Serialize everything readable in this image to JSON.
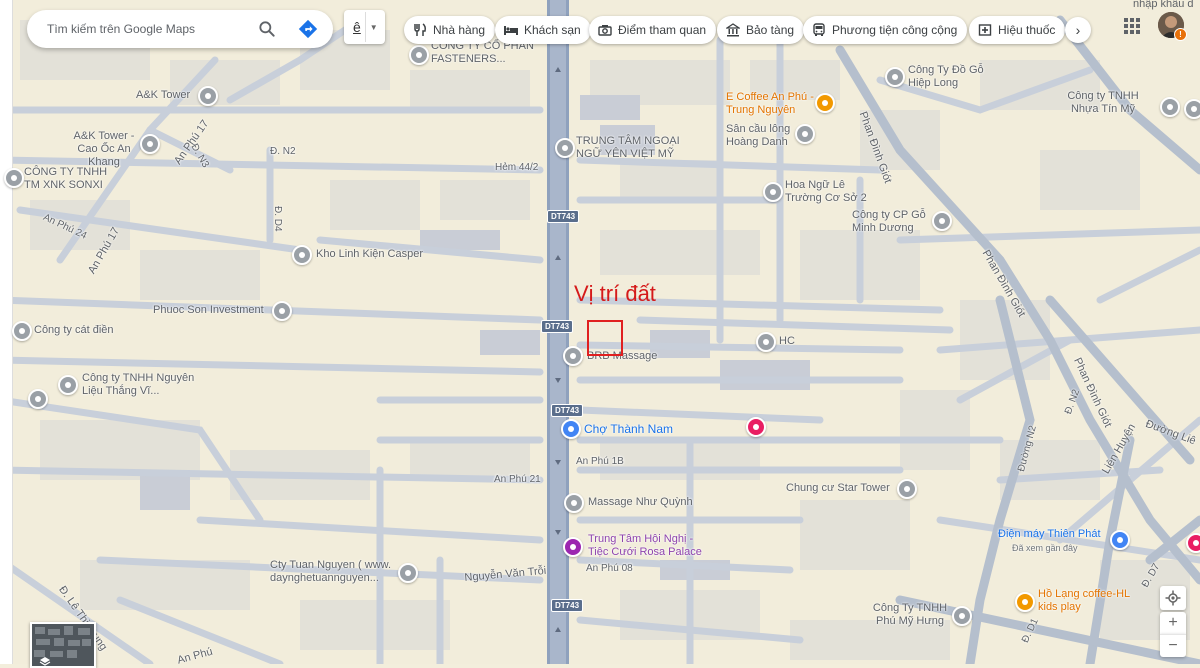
{
  "search": {
    "placeholder": "Tìm kiếm trên Google Maps"
  },
  "language_button": {
    "label": "ê"
  },
  "category_chips": [
    {
      "label": "Nhà hàng",
      "icon": "fork-knife-icon"
    },
    {
      "label": "Khách sạn",
      "icon": "bed-icon"
    },
    {
      "label": "Điểm tham quan",
      "icon": "camera-icon"
    },
    {
      "label": "Bảo tàng",
      "icon": "museum-icon"
    },
    {
      "label": "Phương tiện công cộng",
      "icon": "bus-icon"
    },
    {
      "label": "Hiệu thuốc",
      "icon": "pharmacy-icon"
    }
  ],
  "annotation": {
    "text": "Vị trí đất",
    "color": "#d51a1a"
  },
  "pois": [
    {
      "name": "A&K Tower",
      "kind": "grey"
    },
    {
      "name": "A&K Tower - Cao Ốc An Khang",
      "kind": "grey"
    },
    {
      "name": "CÔNG TY TNHH TM XNK SONXI",
      "kind": "grey"
    },
    {
      "name": "Kho Linh Kiện Casper",
      "kind": "grey"
    },
    {
      "name": "Phuoc Son Investment",
      "kind": "grey"
    },
    {
      "name": "Công ty cát điền",
      "kind": "grey"
    },
    {
      "name": "Công ty TNHH Nguyên Liệu Thắng Vĩ...",
      "kind": "grey"
    },
    {
      "name": "CÔNG TY CỔ PHẦN FASTENERS...",
      "kind": "grey"
    },
    {
      "name": "TRUNG TÂM NGOẠI NGỮ YÊN VIỆT MỸ",
      "kind": "grey"
    },
    {
      "name": "E Coffee An Phú - Trung Nguyên",
      "kind": "orange"
    },
    {
      "name": "Sân cầu lông Hoàng Danh",
      "kind": "grey"
    },
    {
      "name": "Hoa Ngữ Lê Trường Cơ Sở 2",
      "kind": "grey"
    },
    {
      "name": "Công ty CP Gỗ Minh Dương",
      "kind": "grey"
    },
    {
      "name": "Công Ty Đồ Gỗ Hiệp Long",
      "kind": "grey"
    },
    {
      "name": "Công ty TNHH Nhựa Tín Mỹ",
      "kind": "grey"
    },
    {
      "name": "BRB Massage",
      "kind": "grey"
    },
    {
      "name": "HC",
      "kind": "grey"
    },
    {
      "name": "Chợ Thành Nam",
      "kind": "blue"
    },
    {
      "name": "Massage Như Quỳnh",
      "kind": "grey"
    },
    {
      "name": "Chung cư Star Tower",
      "kind": "grey"
    },
    {
      "name": "Trung Tâm Hội Nghị - Tiệc Cưới Rosa Palace",
      "kind": "purple"
    },
    {
      "name": "Cty Tuan Nguyen ( www. daynghetuannguyen...",
      "kind": "grey"
    },
    {
      "name": "Điện máy Thiên Phát",
      "kind": "blue"
    },
    {
      "name": "Hồ Lạng coffee-HL kids play",
      "kind": "orange"
    },
    {
      "name": "Công Ty TNHH Phú Mỹ Hưng",
      "kind": "grey"
    }
  ],
  "poi_subtexts": {
    "dien_may_visited": "Đã xem gần đây"
  },
  "roads": {
    "hem_44_2": "Hẻm 44/2",
    "d_n2_top": "Đ. N2",
    "d_n3": "Đ. N3",
    "d_d4": "Đ. D4",
    "an_phu_17_a": "An Phú 17",
    "an_phu_17_b": "An Phú 17",
    "an_phu_24": "An Phú 24",
    "an_phu_1b": "An Phú 1B",
    "an_phu_21": "An Phú 21",
    "an_phu_08": "An Phú 08",
    "nguyen_van_troi": "Nguyễn Văn Trỗi",
    "le_thi_trung": "Đ. Lê Thị Trung",
    "an_phu_bottom": "An Phú",
    "phan_dinh_giot_a": "Phan Đình Giót",
    "phan_dinh_giot_b": "Phan Đình Giót",
    "phan_dinh_giot_c": "Phan Đình Giót",
    "d_n2_right": "Đ. N2",
    "duong_n2": "Đường N2",
    "lien_huyen": "Liên Huyện",
    "duong_lien": "Đường Liê",
    "d_d7": "Đ. D7",
    "d_d1": "Đ. D1",
    "top_right_cut": "nhập khẩu d"
  },
  "shields": [
    "DT743",
    "DT743",
    "DT743",
    "DT743"
  ]
}
